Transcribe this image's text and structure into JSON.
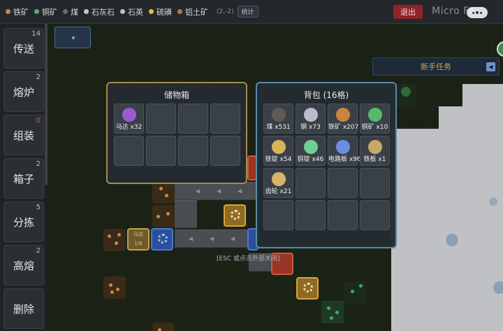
{
  "topbar": {
    "resources": [
      {
        "label": "铁矿",
        "color": "#c58b4c"
      },
      {
        "label": "铜矿",
        "color": "#52b36b"
      },
      {
        "label": "煤",
        "color": "#6b6b6b"
      },
      {
        "label": "石灰石",
        "color": "#c9c9c9"
      },
      {
        "label": "石英",
        "color": "#b9bdd6"
      },
      {
        "label": "硫磺",
        "color": "#d6c04a"
      },
      {
        "label": "铝土矿",
        "color": "#c0714b"
      }
    ],
    "coords": "(2,-2)",
    "stats_label": "统计",
    "exit_label": "退出",
    "app_title": "Micro Fa"
  },
  "toolbar": {
    "tools": [
      {
        "label": "传送",
        "count": "14"
      },
      {
        "label": "熔炉",
        "count": "2"
      },
      {
        "label": "组装",
        "count": "0"
      },
      {
        "label": "箱子",
        "count": "2"
      },
      {
        "label": "分拣",
        "count": "5"
      },
      {
        "label": "高熔",
        "count": "2"
      },
      {
        "label": "删除",
        "count": ""
      }
    ]
  },
  "quest": {
    "label": "新手任务",
    "toggle_glyph": "◀"
  },
  "storage": {
    "title": "储物箱",
    "slots": [
      {
        "label": "马达 x32",
        "icon_color": "#9a5bd0"
      },
      {
        "label": "",
        "icon_color": ""
      },
      {
        "label": "",
        "icon_color": ""
      },
      {
        "label": "",
        "icon_color": ""
      },
      {
        "label": "",
        "icon_color": ""
      },
      {
        "label": "",
        "icon_color": ""
      },
      {
        "label": "",
        "icon_color": ""
      },
      {
        "label": "",
        "icon_color": ""
      }
    ]
  },
  "backpack": {
    "title": "背包 (16格)",
    "slots": [
      {
        "label": "煤 x531",
        "icon_color": "#5e5b57"
      },
      {
        "label": "钢 x73",
        "icon_color": "#b8bccb"
      },
      {
        "label": "铁矿 x207",
        "icon_color": "#c9853f"
      },
      {
        "label": "铜矿 x10",
        "icon_color": "#57b86c"
      },
      {
        "label": "铁锭 x54",
        "icon_color": "#d8b55a"
      },
      {
        "label": "铜锭 x46",
        "icon_color": "#6fd096"
      },
      {
        "label": "电路板 x96",
        "icon_color": "#6b8fe0"
      },
      {
        "label": "铁板 x1",
        "icon_color": "#c9a868"
      },
      {
        "label": "齿轮 x21",
        "icon_color": "#d6b56a"
      },
      {
        "label": "",
        "icon_color": ""
      },
      {
        "label": "",
        "icon_color": ""
      },
      {
        "label": "",
        "icon_color": ""
      },
      {
        "label": "",
        "icon_color": ""
      },
      {
        "label": "",
        "icon_color": ""
      },
      {
        "label": "",
        "icon_color": ""
      },
      {
        "label": "",
        "icon_color": ""
      }
    ]
  },
  "world": {
    "machine_name": "马达",
    "machine_progress": "1/8"
  },
  "hint": "[ESC 或点击外部关闭]"
}
